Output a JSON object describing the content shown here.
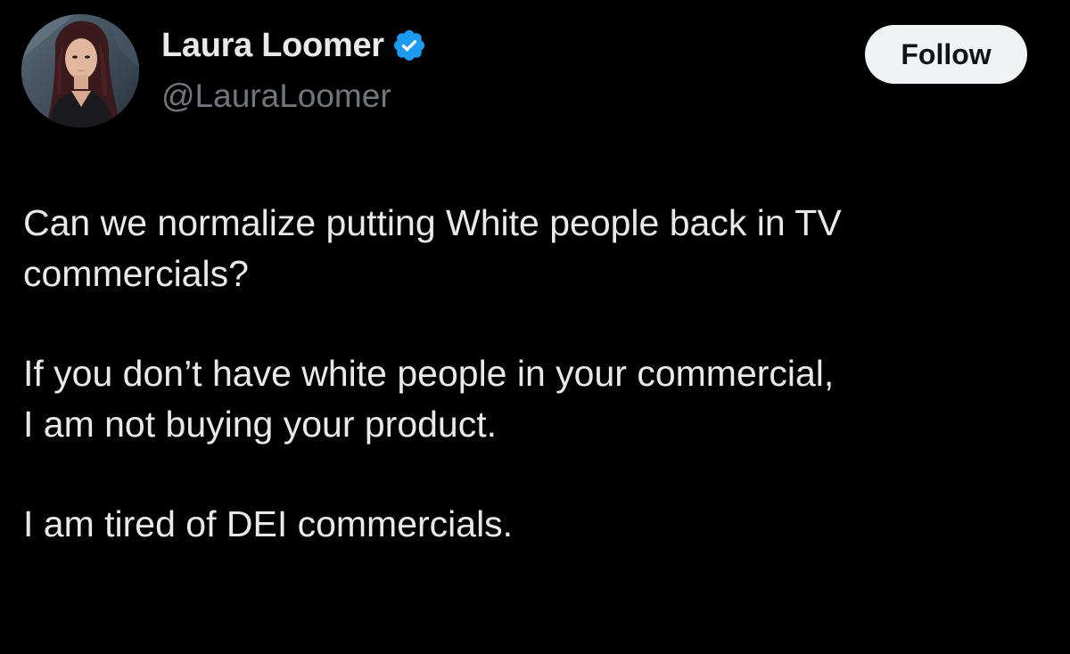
{
  "author": {
    "display_name": "Laura Loomer",
    "handle": "@LauraLoomer",
    "verified": true,
    "verified_icon": "verified-badge-icon",
    "avatar_icon": "profile-photo"
  },
  "actions": {
    "follow_label": "Follow"
  },
  "tweet": {
    "paragraphs": [
      "Can we normalize putting White people back in TV\ncommercials?",
      "If you don’t have white people in your commercial,\nI am not buying your product.",
      "I am tired of DEI commercials."
    ]
  },
  "colors": {
    "background": "#000000",
    "text_primary": "#e7e9ea",
    "text_secondary": "#71767b",
    "verified_blue": "#1d9bf0",
    "button_bg": "#eff3f4",
    "button_text": "#0f1419"
  }
}
